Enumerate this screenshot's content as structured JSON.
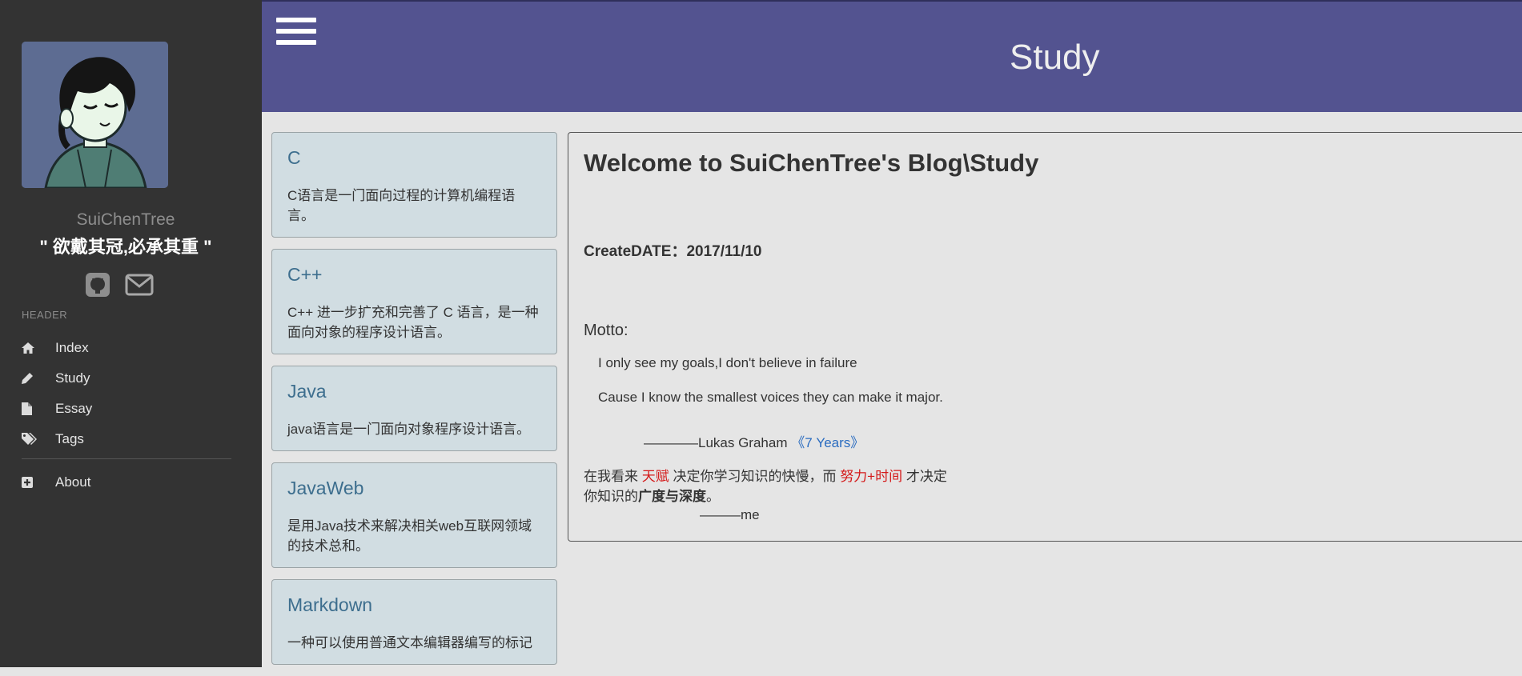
{
  "sidebar": {
    "author_name": "SuiChenTree",
    "motto": "\" 欲戴其冠,必承其重 \"",
    "section_header": "HEADER",
    "nav": [
      {
        "label": "Index",
        "icon": "home-icon"
      },
      {
        "label": "Study",
        "icon": "pencil-icon"
      },
      {
        "label": "Essay",
        "icon": "file-icon"
      },
      {
        "label": "Tags",
        "icon": "tags-icon"
      }
    ],
    "about": {
      "label": "About",
      "icon": "plus-square-icon"
    },
    "social_icons": [
      "github-icon",
      "mail-icon"
    ]
  },
  "header": {
    "title": "Study",
    "menu_icon": "hamburger-icon",
    "background": "#535390"
  },
  "cards": [
    {
      "title": "C",
      "desc": "C语言是一门面向过程的计算机编程语言。"
    },
    {
      "title": "C++",
      "desc": "C++ 进一步扩充和完善了 C 语言，是一种面向对象的程序设计语言。"
    },
    {
      "title": "Java",
      "desc": "java语言是一门面向对象程序设计语言。"
    },
    {
      "title": "JavaWeb",
      "desc": "是用Java技术来解决相关web互联网领域的技术总和。"
    },
    {
      "title": "Markdown",
      "desc": "一种可以使用普通文本编辑器编写的标记"
    }
  ],
  "main": {
    "title": "Welcome to SuiChenTree's Blog\\Study",
    "create_date": "CreateDATE：2017/11/10",
    "motto_label": "Motto:",
    "motto_lines": [
      "I only see my goals,I don't believe in failure",
      "Cause I know the smallest voices they can make it major."
    ],
    "credit_prefix": "————Lukas Graham ",
    "credit_link": "《7 Years》",
    "note": {
      "p1": "在我看来 ",
      "red1": "天赋",
      "p2": " 决定你学习知识的快慢，而 ",
      "red2": "努力+时间",
      "p3": " 才决定你知识的",
      "bold": "广度与深度",
      "p4": "。"
    },
    "signature": "———me"
  },
  "colors": {
    "sidebar_bg": "#333333",
    "card_bg": "#d1dde2",
    "link": "#2a6cc0",
    "highlight_red": "#d41a1a"
  }
}
